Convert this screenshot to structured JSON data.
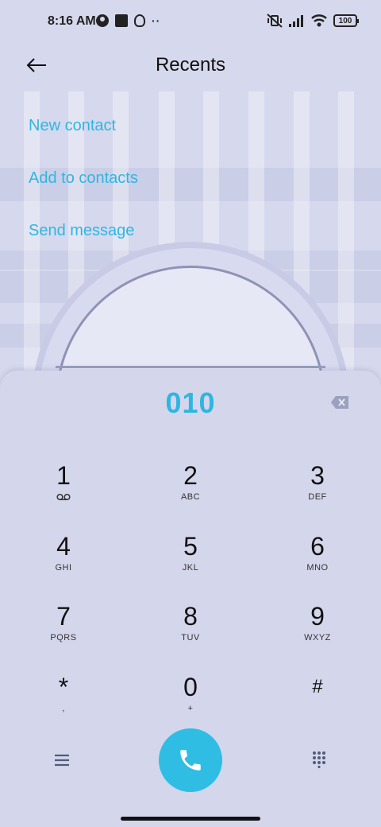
{
  "status_bar": {
    "time": "8:16 AM",
    "more_indicator": "··",
    "battery_level": "100"
  },
  "header": {
    "title": "Recents",
    "back_icon": "arrow-left-icon"
  },
  "actions": [
    {
      "label": "New contact"
    },
    {
      "label": "Add to contacts"
    },
    {
      "label": "Send message"
    }
  ],
  "dialpad": {
    "number": "010",
    "keys": [
      {
        "digit": "1",
        "sub": ""
      },
      {
        "digit": "2",
        "sub": "ABC"
      },
      {
        "digit": "3",
        "sub": "DEF"
      },
      {
        "digit": "4",
        "sub": "GHI"
      },
      {
        "digit": "5",
        "sub": "JKL"
      },
      {
        "digit": "6",
        "sub": "MNO"
      },
      {
        "digit": "7",
        "sub": "PQRS"
      },
      {
        "digit": "8",
        "sub": "TUV"
      },
      {
        "digit": "9",
        "sub": "WXYZ"
      },
      {
        "digit": "*",
        "sub": ","
      },
      {
        "digit": "0",
        "sub": "+"
      },
      {
        "digit": "#",
        "sub": ""
      }
    ]
  },
  "colors": {
    "accent": "#2fb6e0",
    "call_button": "#2fbde4",
    "background": "#d6d8ed"
  }
}
